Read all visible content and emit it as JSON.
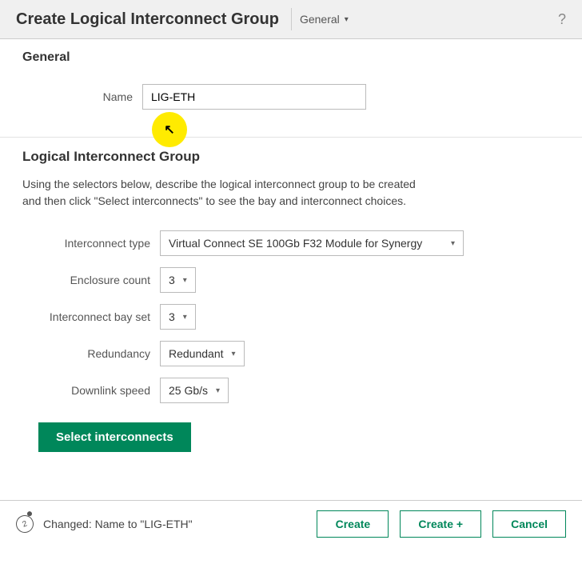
{
  "header": {
    "title": "Create Logical Interconnect Group",
    "dropdown": "General",
    "help": "?"
  },
  "section_general": {
    "title": "General",
    "name_label": "Name",
    "name_value": "LIG-ETH"
  },
  "section_lig": {
    "title": "Logical Interconnect Group",
    "description": "Using the selectors below, describe the logical interconnect group to be created and then click \"Select interconnects\" to see the bay and interconnect choices.",
    "fields": {
      "interconnect_type": {
        "label": "Interconnect type",
        "value": "Virtual Connect SE 100Gb F32 Module for Synergy"
      },
      "enclosure_count": {
        "label": "Enclosure count",
        "value": "3"
      },
      "interconnect_bay_set": {
        "label": "Interconnect bay set",
        "value": "3"
      },
      "redundancy": {
        "label": "Redundancy",
        "value": "Redundant"
      },
      "downlink_speed": {
        "label": "Downlink speed",
        "value": "25 Gb/s"
      }
    },
    "select_button": "Select interconnects"
  },
  "footer": {
    "change_badge": "2",
    "change_text": "Changed: Name to \"LIG-ETH\"",
    "create": "Create",
    "create_plus": "Create +",
    "cancel": "Cancel"
  }
}
